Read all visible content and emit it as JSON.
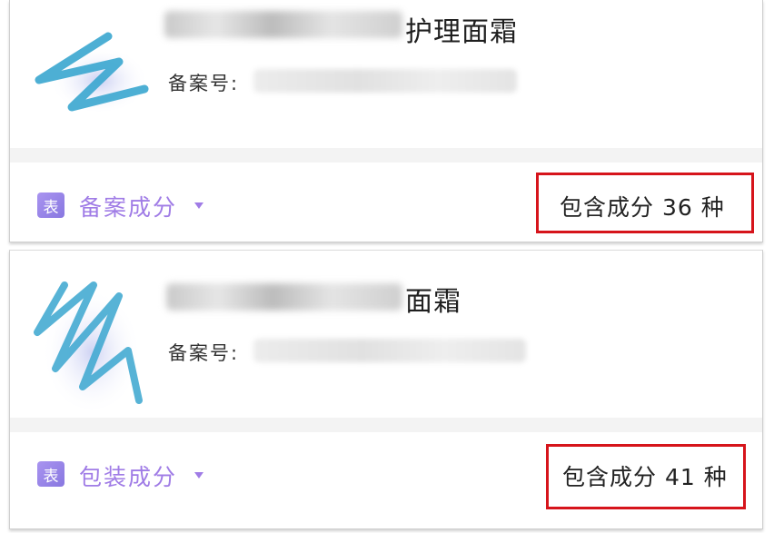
{
  "cards": [
    {
      "product_name_visible": "护理面霜",
      "record_label": "备案号:",
      "tag_icon_text": "表",
      "ingredient_type": "备案成分",
      "ingredient_count": "包含成分 36 种"
    },
    {
      "product_name_visible": "面霜",
      "record_label": "备案号:",
      "tag_icon_text": "表",
      "ingredient_type": "包装成分",
      "ingredient_count": "包含成分 41 种"
    }
  ],
  "colors": {
    "accent_purple": "#a07ce6",
    "highlight_red": "#d6141b",
    "scribble_blue": "#3aa6cf"
  }
}
